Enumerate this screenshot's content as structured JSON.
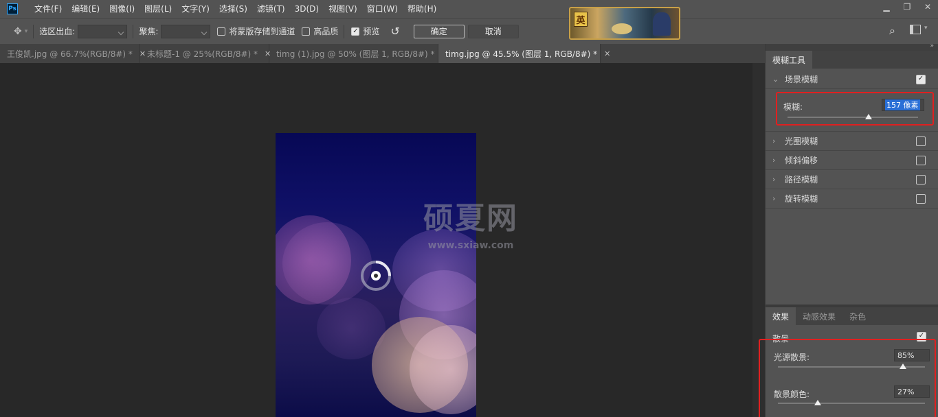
{
  "menubar": {
    "logo": "Ps",
    "items": [
      "文件(F)",
      "编辑(E)",
      "图像(I)",
      "图层(L)",
      "文字(Y)",
      "选择(S)",
      "滤镜(T)",
      "3D(D)",
      "视图(V)",
      "窗口(W)",
      "帮助(H)"
    ],
    "banner_badge": "英"
  },
  "options": {
    "selection_bleed_label": "选区出血:",
    "focus_label": "聚焦:",
    "save_mask_label": "将蒙版存储到通道",
    "high_quality_label": "高品质",
    "preview_label": "预览",
    "preview_checked": true,
    "ok_label": "确定",
    "cancel_label": "取消"
  },
  "tabs": [
    {
      "label": "王俊凯.jpg @ 66.7%(RGB/8#) *",
      "active": false
    },
    {
      "label": "未标题-1 @ 25%(RGB/8#) *",
      "active": false
    },
    {
      "label": "timg (1).jpg @ 50% (图层 1, RGB/8#) *",
      "active": false
    },
    {
      "label": "timg.jpg @ 45.5% (图层 1, RGB/8#) *",
      "active": true
    }
  ],
  "canvas": {
    "watermark_title": "硕夏网",
    "watermark_url": "www.sxiaw.com"
  },
  "blur_panel": {
    "tab_label": "模糊工具",
    "field_blur": {
      "label": "场景模糊",
      "checked": true
    },
    "blur_label": "模糊:",
    "blur_value": "157 像素",
    "blur_slider_fraction": 0.62,
    "other_blurs": [
      {
        "label": "光圈模糊",
        "checked": false
      },
      {
        "label": "倾斜偏移",
        "checked": false
      },
      {
        "label": "路径模糊",
        "checked": false
      },
      {
        "label": "旋转模糊",
        "checked": false
      }
    ]
  },
  "effects_panel": {
    "tabs": [
      "效果",
      "动感效果",
      "杂色"
    ],
    "bokeh_label": "散景",
    "bokeh_checked": true,
    "light_bokeh_label": "光源散景:",
    "light_bokeh_value": "85%",
    "light_bokeh_fraction": 0.85,
    "bokeh_color_label": "散景颜色:",
    "bokeh_color_value": "27%",
    "bokeh_color_fraction": 0.27
  },
  "colors": {
    "highlight_box": "#e02020",
    "selection_highlight": "#2a6fd6"
  }
}
